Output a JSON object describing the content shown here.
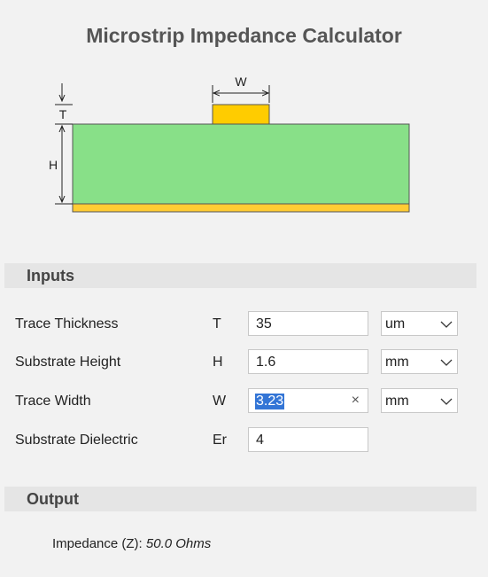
{
  "title": "Microstrip Impedance Calculator",
  "diagram": {
    "labels": {
      "w": "W",
      "t": "T",
      "h": "H"
    },
    "colors": {
      "substrate": "#88e088",
      "trace": "#ffcc00",
      "ground": "#ffcc33"
    }
  },
  "inputs": {
    "header": "Inputs",
    "rows": [
      {
        "label": "Trace Thickness",
        "symbol": "T",
        "value": "35",
        "unit": "um"
      },
      {
        "label": "Substrate Height",
        "symbol": "H",
        "value": "1.6",
        "unit": "mm"
      },
      {
        "label": "Trace Width",
        "symbol": "W",
        "value": "3.23",
        "unit": "mm",
        "clear_icon": "×"
      },
      {
        "label": "Substrate Dielectric",
        "symbol": "Er",
        "value": "4"
      }
    ]
  },
  "output": {
    "header": "Output",
    "label": "Impedance (Z):",
    "value": "50.0 Ohms"
  }
}
